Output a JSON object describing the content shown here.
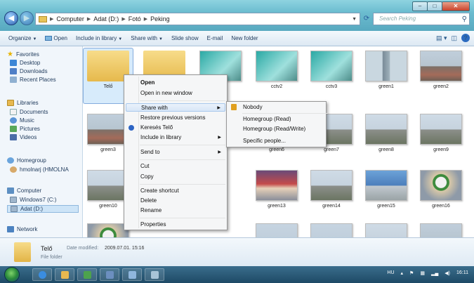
{
  "titlebar": {
    "breadcrumb": [
      "Computer",
      "Adat (D:)",
      "Fotó",
      "Peking"
    ],
    "search_placeholder": "Search Peking",
    "window_buttons": [
      "minimize-icon",
      "maximize-icon",
      "close-icon"
    ]
  },
  "toolbar": {
    "organize": "Organize",
    "open": "Open",
    "include": "Include in library",
    "share": "Share with",
    "slideshow": "Slide show",
    "email": "E-mail",
    "newfolder": "New folder"
  },
  "nav": {
    "favorites": "Favorites",
    "desktop": "Desktop",
    "downloads": "Downloads",
    "recent": "Recent Places",
    "libraries": "Libraries",
    "documents": "Documents",
    "music": "Music",
    "pictures": "Pictures",
    "videos": "Videos",
    "homegroup": "Homegroup",
    "hguser": "hmolnarj (HMOLNA",
    "computer": "Computer",
    "c_drive": "Windows7 (C:)",
    "d_drive": "Adat (D:)",
    "network": "Network"
  },
  "files": [
    {
      "name": "Telő",
      "kind": "folder"
    },
    {
      "name": "",
      "kind": "folder"
    },
    {
      "name": "",
      "kind": "photo"
    },
    {
      "name": "cctv2",
      "kind": "photo"
    },
    {
      "name": "cctv3",
      "kind": "photo"
    },
    {
      "name": "green1",
      "kind": "photo"
    },
    {
      "name": "green2",
      "kind": "photo"
    },
    {
      "name": "green3",
      "kind": "photo"
    },
    {
      "name": "green6",
      "kind": "photo"
    },
    {
      "name": "green7",
      "kind": "photo"
    },
    {
      "name": "green8",
      "kind": "photo"
    },
    {
      "name": "green9",
      "kind": "photo"
    },
    {
      "name": "green10",
      "kind": "photo"
    },
    {
      "name": "green13",
      "kind": "photo"
    },
    {
      "name": "green14",
      "kind": "photo"
    },
    {
      "name": "green15",
      "kind": "photo"
    },
    {
      "name": "green16",
      "kind": "photo"
    }
  ],
  "context_menu": {
    "open": "Open",
    "open_new": "Open in new window",
    "share": "Share with",
    "restore": "Restore previous versions",
    "search": "Keresés Telő",
    "include": "Include in library",
    "sendto": "Send to",
    "cut": "Cut",
    "copy": "Copy",
    "shortcut": "Create shortcut",
    "delete": "Delete",
    "rename": "Rename",
    "properties": "Properties"
  },
  "share_submenu": {
    "nobody": "Nobody",
    "hg_read": "Homegroup (Read)",
    "hg_rw": "Homegroup (Read/Write)",
    "specific": "Specific people..."
  },
  "details": {
    "name": "Telő",
    "modified_label": "Date modified:",
    "modified_value": "2009.07.01. 15:16",
    "type": "File folder"
  },
  "taskbar": {
    "lang": "HU",
    "clock": "16:11"
  }
}
